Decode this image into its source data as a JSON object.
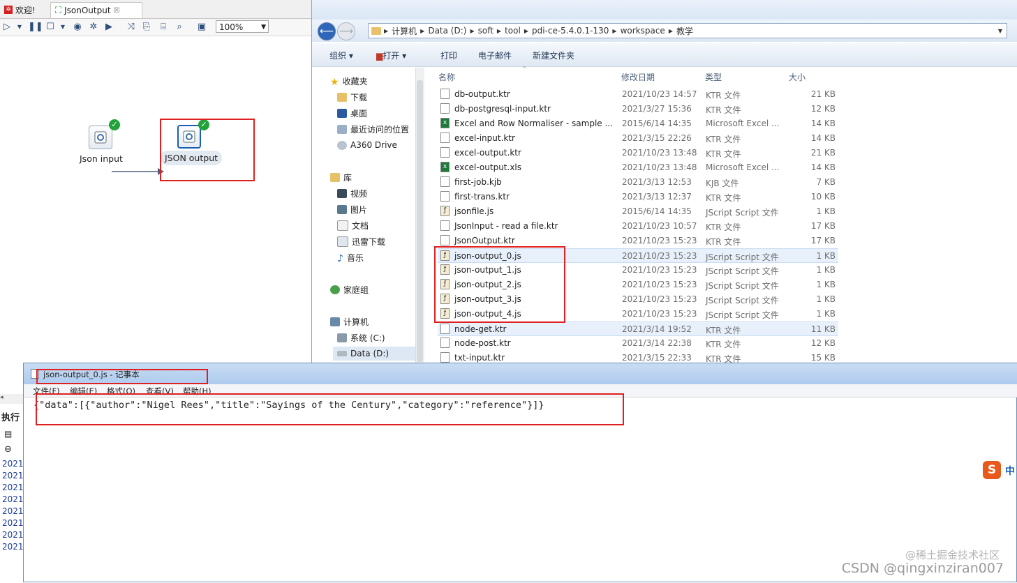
{
  "kettle": {
    "tabs": [
      {
        "label": "欢迎!"
      },
      {
        "label": "JsonOutput",
        "close": "☒"
      }
    ],
    "zoom": "100%",
    "steps": [
      {
        "label": "Json input"
      },
      {
        "label": "JSON output"
      }
    ],
    "bottom_panel": {
      "title": "执行",
      "log_entries": [
        "2021",
        "2021",
        "2021",
        "2021",
        "2021",
        "2021",
        "2021",
        "2021"
      ]
    }
  },
  "explorer": {
    "breadcrumb": [
      "计算机",
      "Data (D:)",
      "soft",
      "tool",
      "pdi-ce-5.4.0.1-130",
      "workspace",
      "教学"
    ],
    "commands": [
      "组织",
      "打开",
      "打印",
      "电子邮件",
      "新建文件夹"
    ],
    "nav": {
      "favorites": {
        "label": "收藏夹",
        "items": [
          "下载",
          "桌面",
          "最近访问的位置",
          "A360 Drive"
        ]
      },
      "libraries": {
        "label": "库",
        "items": [
          "视频",
          "图片",
          "文档",
          "迅雷下载",
          "音乐"
        ]
      },
      "homegroup": "家庭组",
      "computer": {
        "label": "计算机",
        "items": [
          "系统 (C:)",
          "Data (D:)"
        ]
      }
    },
    "columns": {
      "name": "名称",
      "date": "修改日期",
      "type": "类型",
      "size": "大小"
    },
    "files": [
      {
        "name": "db-output.ktr",
        "date": "2021/10/23 14:57",
        "type": "KTR 文件",
        "size": "21 KB",
        "icon": "doc"
      },
      {
        "name": "db-postgresql-input.ktr",
        "date": "2021/3/27 15:36",
        "type": "KTR 文件",
        "size": "12 KB",
        "icon": "doc"
      },
      {
        "name": "Excel and Row Normaliser - sample ...",
        "date": "2015/6/14 14:35",
        "type": "Microsoft Excel ...",
        "size": "14 KB",
        "icon": "xls"
      },
      {
        "name": "excel-input.ktr",
        "date": "2021/3/15 22:26",
        "type": "KTR 文件",
        "size": "14 KB",
        "icon": "doc"
      },
      {
        "name": "excel-output.ktr",
        "date": "2021/10/23 13:48",
        "type": "KTR 文件",
        "size": "21 KB",
        "icon": "doc"
      },
      {
        "name": "excel-output.xls",
        "date": "2021/10/23 13:48",
        "type": "Microsoft Excel ...",
        "size": "14 KB",
        "icon": "xls"
      },
      {
        "name": "first-job.kjb",
        "date": "2021/3/13 12:53",
        "type": "KJB 文件",
        "size": "7 KB",
        "icon": "doc"
      },
      {
        "name": "first-trans.ktr",
        "date": "2021/3/13 12:37",
        "type": "KTR 文件",
        "size": "10 KB",
        "icon": "doc"
      },
      {
        "name": "jsonfile.js",
        "date": "2015/6/14 14:35",
        "type": "JScript Script 文件",
        "size": "1 KB",
        "icon": "js"
      },
      {
        "name": "JsonInput - read a file.ktr",
        "date": "2021/10/23 10:57",
        "type": "KTR 文件",
        "size": "17 KB",
        "icon": "doc"
      },
      {
        "name": "JsonOutput.ktr",
        "date": "2021/10/23 15:23",
        "type": "KTR 文件",
        "size": "17 KB",
        "icon": "doc"
      },
      {
        "name": "json-output_0.js",
        "date": "2021/10/23 15:23",
        "type": "JScript Script 文件",
        "size": "1 KB",
        "icon": "js",
        "selected": true
      },
      {
        "name": "json-output_1.js",
        "date": "2021/10/23 15:23",
        "type": "JScript Script 文件",
        "size": "1 KB",
        "icon": "js"
      },
      {
        "name": "json-output_2.js",
        "date": "2021/10/23 15:23",
        "type": "JScript Script 文件",
        "size": "1 KB",
        "icon": "js"
      },
      {
        "name": "json-output_3.js",
        "date": "2021/10/23 15:23",
        "type": "JScript Script 文件",
        "size": "1 KB",
        "icon": "js"
      },
      {
        "name": "json-output_4.js",
        "date": "2021/10/23 15:23",
        "type": "JScript Script 文件",
        "size": "1 KB",
        "icon": "js"
      },
      {
        "name": "node-get.ktr",
        "date": "2021/3/14 19:52",
        "type": "KTR 文件",
        "size": "11 KB",
        "icon": "doc",
        "selected": true
      },
      {
        "name": "node-post.ktr",
        "date": "2021/3/14 22:38",
        "type": "KTR 文件",
        "size": "12 KB",
        "icon": "doc"
      },
      {
        "name": "txt-input.ktr",
        "date": "2021/3/15 22:33",
        "type": "KTR 文件",
        "size": "15 KB",
        "icon": "doc"
      }
    ]
  },
  "notepad": {
    "title": "json-output_0.js - 记事本",
    "menu": [
      "文件(F)",
      "编辑(E)",
      "格式(O)",
      "查看(V)",
      "帮助(H)"
    ],
    "content": "{\"data\":[{\"author\":\"Nigel Rees\",\"title\":\"Sayings of the Century\",\"category\":\"reference\"}]}"
  },
  "ime_label": "中",
  "watermark_top": "@稀土掘金技术社区",
  "watermark_bottom": "CSDN @qingxinziran007",
  "colors": {
    "highlight_red": "#e02020",
    "accent_blue": "#1a5fb4",
    "check_green": "#23a23a"
  }
}
